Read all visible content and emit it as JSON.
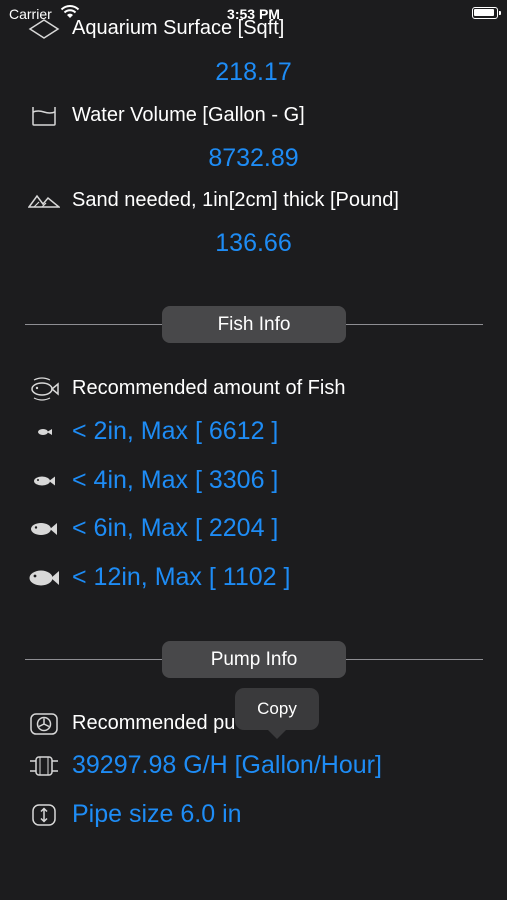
{
  "status_bar": {
    "carrier": "Carrier",
    "time": "3:53 PM"
  },
  "surface": {
    "label": "Aquarium Surface [Sqft]",
    "value": "218.17",
    "icon": "diamond-icon"
  },
  "volume": {
    "label": "Water Volume [Gallon - G]",
    "value": "8732.89",
    "icon": "water-tank-icon"
  },
  "sand": {
    "label": "Sand needed, 1in[2cm] thick [Pound]",
    "value": "136.66",
    "icon": "sand-dunes-icon"
  },
  "fish_section": {
    "button_label": "Fish Info",
    "header_label": "Recommended amount of Fish",
    "header_icon": "fish-group-icon",
    "items": [
      {
        "text": "< 2in, Max [ 6612 ]",
        "icon": "fish-icon"
      },
      {
        "text": "< 4in, Max [ 3306 ]",
        "icon": "fish-icon"
      },
      {
        "text": "< 6in, Max [ 2204 ]",
        "icon": "fish-icon"
      },
      {
        "text": "< 12in, Max [ 1102 ]",
        "icon": "fish-icon"
      }
    ]
  },
  "pump_section": {
    "button_label": "Pump Info",
    "header_label": "Recommended pu",
    "header_icon": "pump-fan-icon",
    "flow_rate": {
      "text": "39297.98 G/H [Gallon/Hour]",
      "icon": "pipe-icon"
    },
    "pipe_size": {
      "text": "Pipe size 6.0 in",
      "icon": "pipe-size-icon"
    }
  },
  "tooltip": {
    "label": "Copy"
  }
}
